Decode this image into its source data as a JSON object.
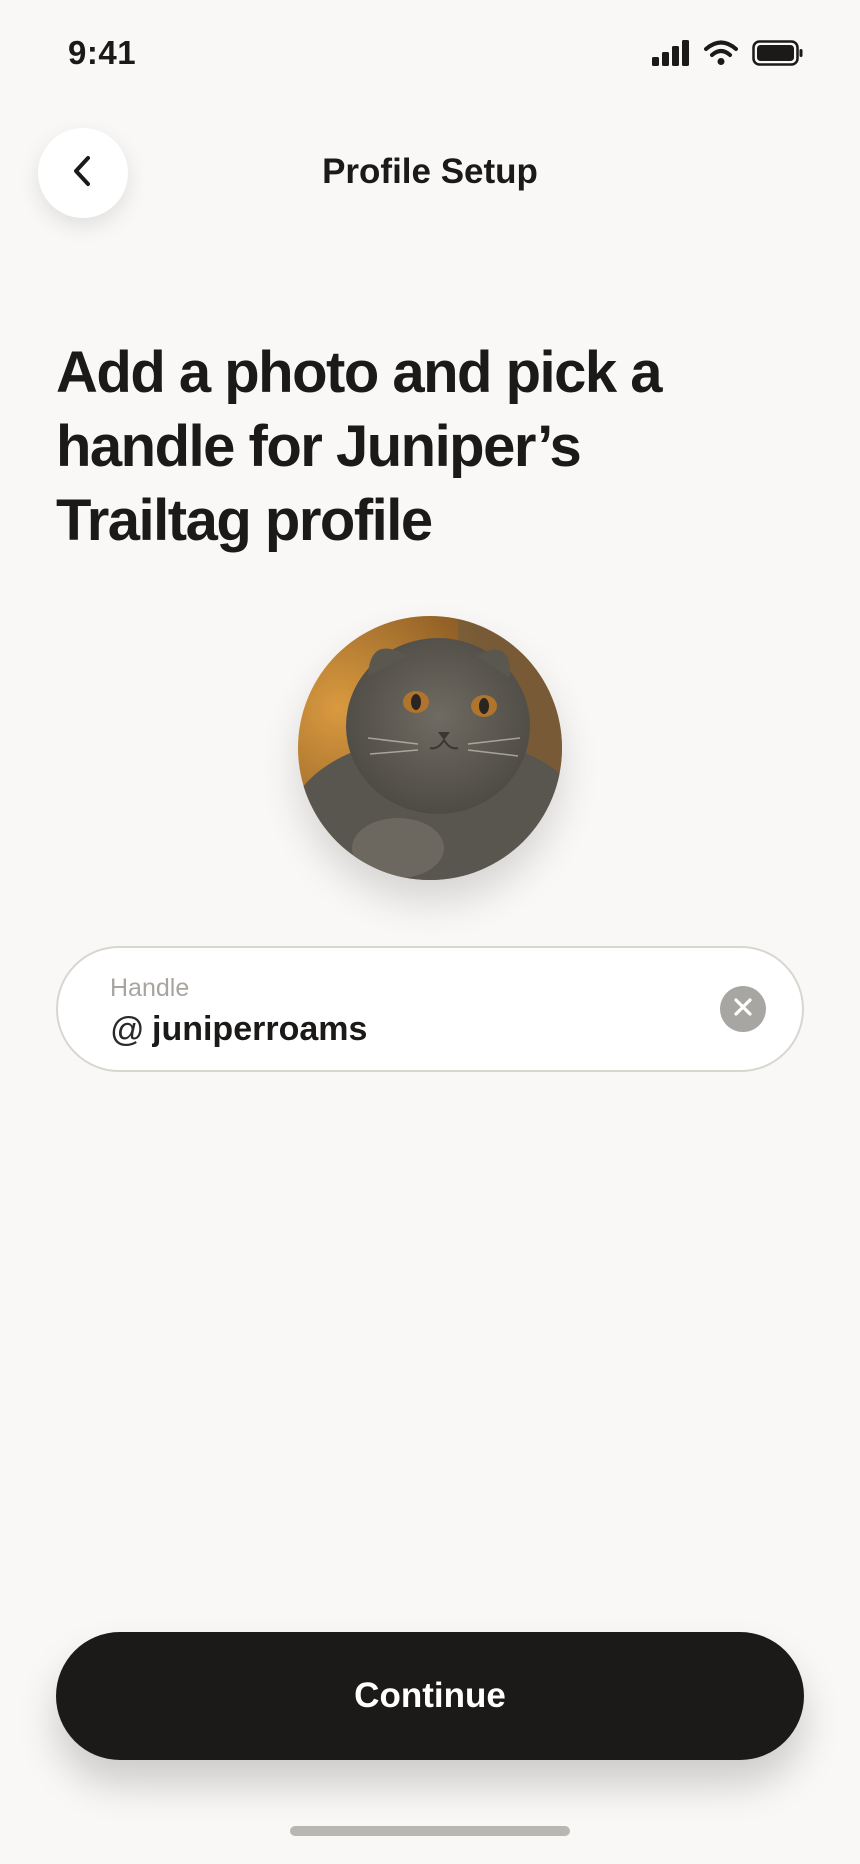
{
  "status_bar": {
    "time": "9:41",
    "icons": [
      "cellular-signal-icon",
      "wifi-icon",
      "battery-icon"
    ]
  },
  "header": {
    "back_icon": "chevron-left-icon",
    "title": "Profile Setup"
  },
  "main": {
    "headline": "Add a photo and pick a handle for Juniper’s Trailtag profile",
    "avatar_icon": "cat-photo",
    "handle": {
      "label": "Handle",
      "prefix": "@",
      "value": "juniperroams",
      "clear_icon": "clear-x-icon"
    }
  },
  "footer": {
    "continue_label": "Continue"
  },
  "colors": {
    "background": "#f9f8f6",
    "primary_button": "#1b1a19",
    "field_border": "#d9d6d0",
    "clear_button": "#a8a6a3"
  }
}
